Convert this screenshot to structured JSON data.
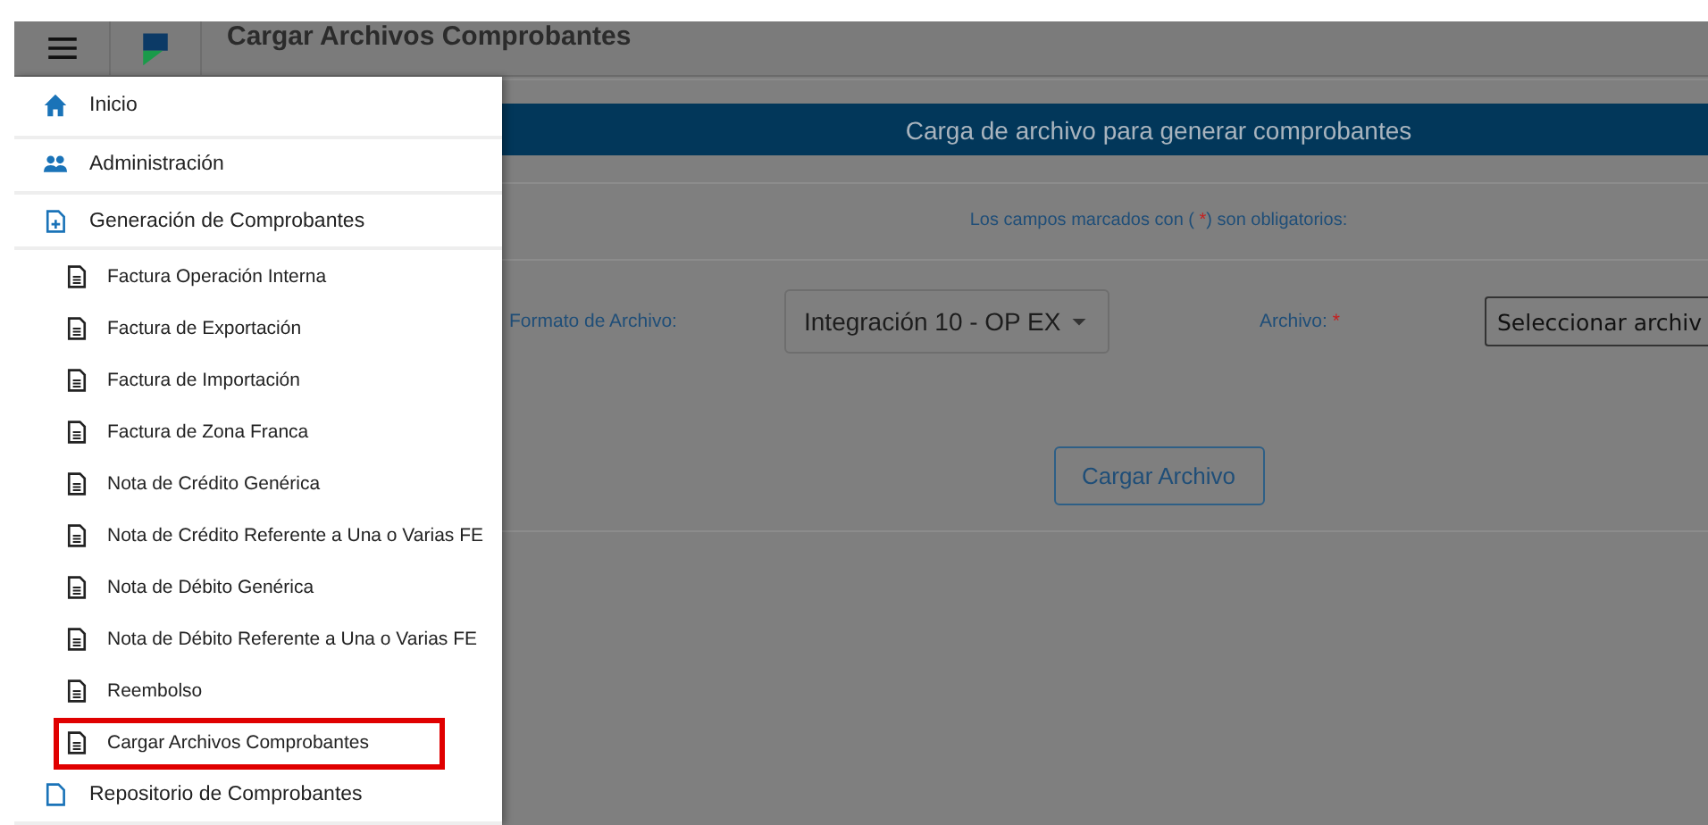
{
  "header": {
    "title": "Cargar Archivos Comprobantes"
  },
  "sidebar": {
    "items": [
      {
        "label": "Inicio",
        "kind": "home",
        "highlighted": false
      },
      {
        "label": "Administración",
        "kind": "people",
        "highlighted": false
      },
      {
        "label": "Generación de Comprobantes",
        "kind": "file-plus",
        "highlighted": false,
        "children": [
          {
            "label": "Factura Operación Interna",
            "highlighted": false
          },
          {
            "label": "Factura de Exportación",
            "highlighted": false
          },
          {
            "label": "Factura de Importación",
            "highlighted": false
          },
          {
            "label": "Factura de Zona Franca",
            "highlighted": false
          },
          {
            "label": "Nota de Crédito Genérica",
            "highlighted": false
          },
          {
            "label": "Nota de Crédito Referente a Una o Varias FE",
            "highlighted": false
          },
          {
            "label": "Nota de Débito Genérica",
            "highlighted": false
          },
          {
            "label": "Nota de Débito Referente a Una o Varias FE",
            "highlighted": false
          },
          {
            "label": "Reembolso",
            "highlighted": false
          },
          {
            "label": "Cargar Archivos Comprobantes",
            "highlighted": true
          }
        ]
      },
      {
        "label": "Repositorio de Comprobantes",
        "kind": "file",
        "highlighted": false
      }
    ]
  },
  "panel": {
    "title": "Carga de archivo para generar comprobantes",
    "notice_before": "Los campos marcados con (",
    "notice_mark": "*",
    "notice_after": ") son obligatorios:",
    "format_label": "Formato de Archivo:",
    "format_value": "Integración 10 - OP EX",
    "file_label": "Archivo:",
    "file_required": "*",
    "file_button": "Seleccionar archiv",
    "submit": "Cargar Archivo"
  }
}
